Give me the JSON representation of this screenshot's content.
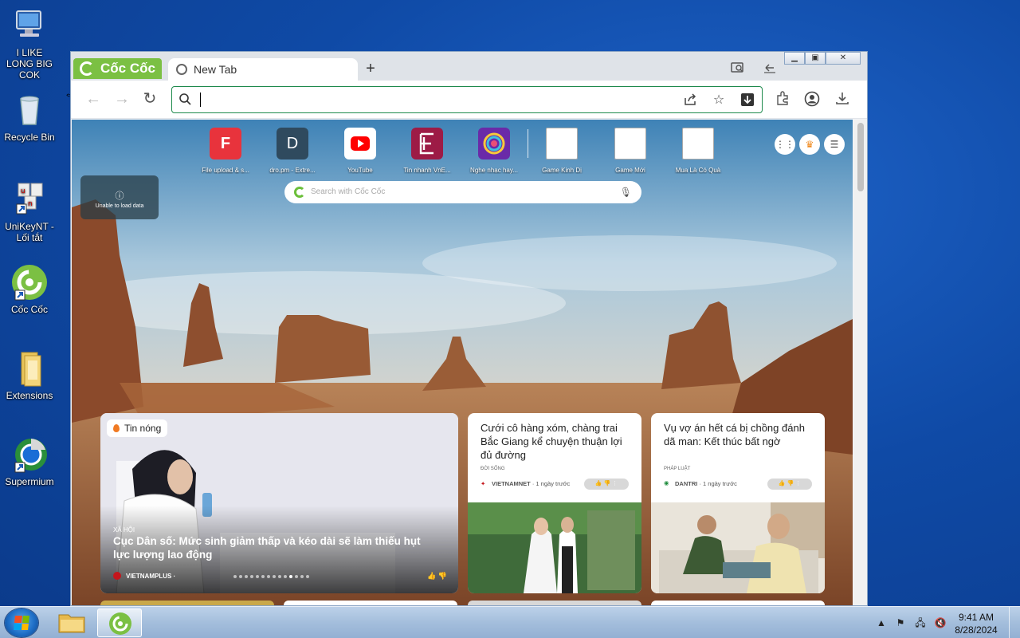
{
  "desktop": {
    "icons": [
      {
        "label": "I LIKE LONG BIG COK",
        "icon": "computer-icon"
      },
      {
        "label": "Recycle Bin",
        "icon": "recycle-bin-icon"
      },
      {
        "label": "UniKeyNT - Lối tắt",
        "icon": "unikey-icon"
      },
      {
        "label": "Cốc Cốc",
        "icon": "coccoc-icon"
      },
      {
        "label": "Extensions",
        "icon": "folder-icon"
      },
      {
        "label": "Supermium",
        "icon": "supermium-icon"
      }
    ]
  },
  "browser": {
    "brand": "Cốc Cốc",
    "tab_title": "New Tab",
    "new_tab_symbol": "+",
    "address_value": "",
    "speed_dials": [
      {
        "label": "File upload & s...",
        "glyph": "F",
        "color": "#e8333c"
      },
      {
        "label": "dro.pm - Extre...",
        "glyph": "D",
        "color": "#2f4a5e"
      },
      {
        "label": "YouTube",
        "glyph": "▶",
        "color": "#ffffff"
      },
      {
        "label": "Tin nhanh VnE...",
        "glyph": "E",
        "color": "#9d1b46"
      },
      {
        "label": "Nghe nhạc hay...",
        "glyph": "◉",
        "color": "#6a2aa8"
      },
      {
        "label": "Game Kinh Dị",
        "glyph": "",
        "color": ""
      },
      {
        "label": "Game Mới",
        "glyph": "",
        "color": ""
      },
      {
        "label": "Mua Là Có Quà",
        "glyph": "",
        "color": ""
      }
    ],
    "error_text": "Unable to load data",
    "search_placeholder": "Search with Cốc Cốc",
    "hero": {
      "badge": "Tin nóng",
      "category": "XÃ HỘI",
      "title": "Cục Dân số: Mức sinh giảm thấp và kéo dài sẽ làm thiếu hụt lực lượng lao động",
      "source": "VIETNAMPLUS ·",
      "dots": 14,
      "active_dot": 10
    },
    "cards": [
      {
        "title": "Cưới cô hàng xóm, chàng trai Bắc Giang kể chuyện thuận lợi đủ đường",
        "category": "ĐỜI SỐNG",
        "source": "VIETNAMNET",
        "time": "· 1 ngày trước"
      },
      {
        "title": "Vụ vợ án hết cá bị chồng đánh dã man: Kết thúc bất ngờ",
        "category": "PHÁP LUẬT",
        "source": "DANTRI",
        "time": "· 1 ngày trước"
      }
    ]
  },
  "taskbar": {
    "time": "9:41 AM",
    "date": "8/28/2024"
  },
  "colors": {
    "accent_green": "#7bc043",
    "omnibox_border": "#1e8a4c",
    "taskbar": "#a4bedc"
  }
}
